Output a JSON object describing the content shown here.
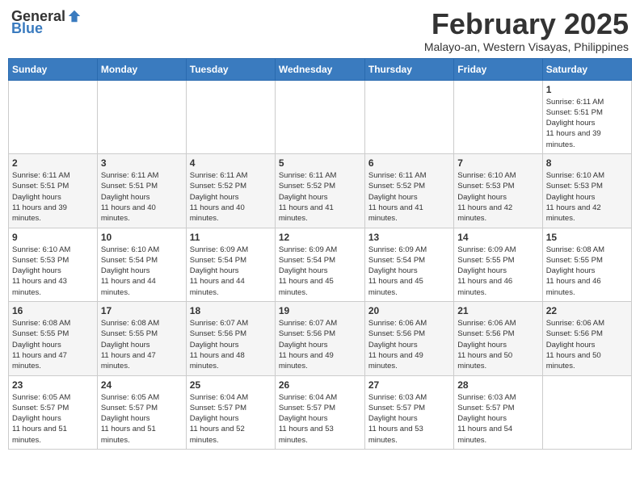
{
  "header": {
    "logo_general": "General",
    "logo_blue": "Blue",
    "month_title": "February 2025",
    "subtitle": "Malayo-an, Western Visayas, Philippines"
  },
  "weekdays": [
    "Sunday",
    "Monday",
    "Tuesday",
    "Wednesday",
    "Thursday",
    "Friday",
    "Saturday"
  ],
  "weeks": [
    [
      {
        "day": "",
        "sunrise": "",
        "sunset": "",
        "daylight": ""
      },
      {
        "day": "",
        "sunrise": "",
        "sunset": "",
        "daylight": ""
      },
      {
        "day": "",
        "sunrise": "",
        "sunset": "",
        "daylight": ""
      },
      {
        "day": "",
        "sunrise": "",
        "sunset": "",
        "daylight": ""
      },
      {
        "day": "",
        "sunrise": "",
        "sunset": "",
        "daylight": ""
      },
      {
        "day": "",
        "sunrise": "",
        "sunset": "",
        "daylight": ""
      },
      {
        "day": "1",
        "sunrise": "6:11 AM",
        "sunset": "5:51 PM",
        "daylight": "11 hours and 39 minutes."
      }
    ],
    [
      {
        "day": "2",
        "sunrise": "6:11 AM",
        "sunset": "5:51 PM",
        "daylight": "11 hours and 39 minutes."
      },
      {
        "day": "3",
        "sunrise": "6:11 AM",
        "sunset": "5:51 PM",
        "daylight": "11 hours and 40 minutes."
      },
      {
        "day": "4",
        "sunrise": "6:11 AM",
        "sunset": "5:52 PM",
        "daylight": "11 hours and 40 minutes."
      },
      {
        "day": "5",
        "sunrise": "6:11 AM",
        "sunset": "5:52 PM",
        "daylight": "11 hours and 41 minutes."
      },
      {
        "day": "6",
        "sunrise": "6:11 AM",
        "sunset": "5:52 PM",
        "daylight": "11 hours and 41 minutes."
      },
      {
        "day": "7",
        "sunrise": "6:10 AM",
        "sunset": "5:53 PM",
        "daylight": "11 hours and 42 minutes."
      },
      {
        "day": "8",
        "sunrise": "6:10 AM",
        "sunset": "5:53 PM",
        "daylight": "11 hours and 42 minutes."
      }
    ],
    [
      {
        "day": "9",
        "sunrise": "6:10 AM",
        "sunset": "5:53 PM",
        "daylight": "11 hours and 43 minutes."
      },
      {
        "day": "10",
        "sunrise": "6:10 AM",
        "sunset": "5:54 PM",
        "daylight": "11 hours and 44 minutes."
      },
      {
        "day": "11",
        "sunrise": "6:09 AM",
        "sunset": "5:54 PM",
        "daylight": "11 hours and 44 minutes."
      },
      {
        "day": "12",
        "sunrise": "6:09 AM",
        "sunset": "5:54 PM",
        "daylight": "11 hours and 45 minutes."
      },
      {
        "day": "13",
        "sunrise": "6:09 AM",
        "sunset": "5:54 PM",
        "daylight": "11 hours and 45 minutes."
      },
      {
        "day": "14",
        "sunrise": "6:09 AM",
        "sunset": "5:55 PM",
        "daylight": "11 hours and 46 minutes."
      },
      {
        "day": "15",
        "sunrise": "6:08 AM",
        "sunset": "5:55 PM",
        "daylight": "11 hours and 46 minutes."
      }
    ],
    [
      {
        "day": "16",
        "sunrise": "6:08 AM",
        "sunset": "5:55 PM",
        "daylight": "11 hours and 47 minutes."
      },
      {
        "day": "17",
        "sunrise": "6:08 AM",
        "sunset": "5:55 PM",
        "daylight": "11 hours and 47 minutes."
      },
      {
        "day": "18",
        "sunrise": "6:07 AM",
        "sunset": "5:56 PM",
        "daylight": "11 hours and 48 minutes."
      },
      {
        "day": "19",
        "sunrise": "6:07 AM",
        "sunset": "5:56 PM",
        "daylight": "11 hours and 49 minutes."
      },
      {
        "day": "20",
        "sunrise": "6:06 AM",
        "sunset": "5:56 PM",
        "daylight": "11 hours and 49 minutes."
      },
      {
        "day": "21",
        "sunrise": "6:06 AM",
        "sunset": "5:56 PM",
        "daylight": "11 hours and 50 minutes."
      },
      {
        "day": "22",
        "sunrise": "6:06 AM",
        "sunset": "5:56 PM",
        "daylight": "11 hours and 50 minutes."
      }
    ],
    [
      {
        "day": "23",
        "sunrise": "6:05 AM",
        "sunset": "5:57 PM",
        "daylight": "11 hours and 51 minutes."
      },
      {
        "day": "24",
        "sunrise": "6:05 AM",
        "sunset": "5:57 PM",
        "daylight": "11 hours and 51 minutes."
      },
      {
        "day": "25",
        "sunrise": "6:04 AM",
        "sunset": "5:57 PM",
        "daylight": "11 hours and 52 minutes."
      },
      {
        "day": "26",
        "sunrise": "6:04 AM",
        "sunset": "5:57 PM",
        "daylight": "11 hours and 53 minutes."
      },
      {
        "day": "27",
        "sunrise": "6:03 AM",
        "sunset": "5:57 PM",
        "daylight": "11 hours and 53 minutes."
      },
      {
        "day": "28",
        "sunrise": "6:03 AM",
        "sunset": "5:57 PM",
        "daylight": "11 hours and 54 minutes."
      },
      {
        "day": "",
        "sunrise": "",
        "sunset": "",
        "daylight": ""
      }
    ]
  ]
}
